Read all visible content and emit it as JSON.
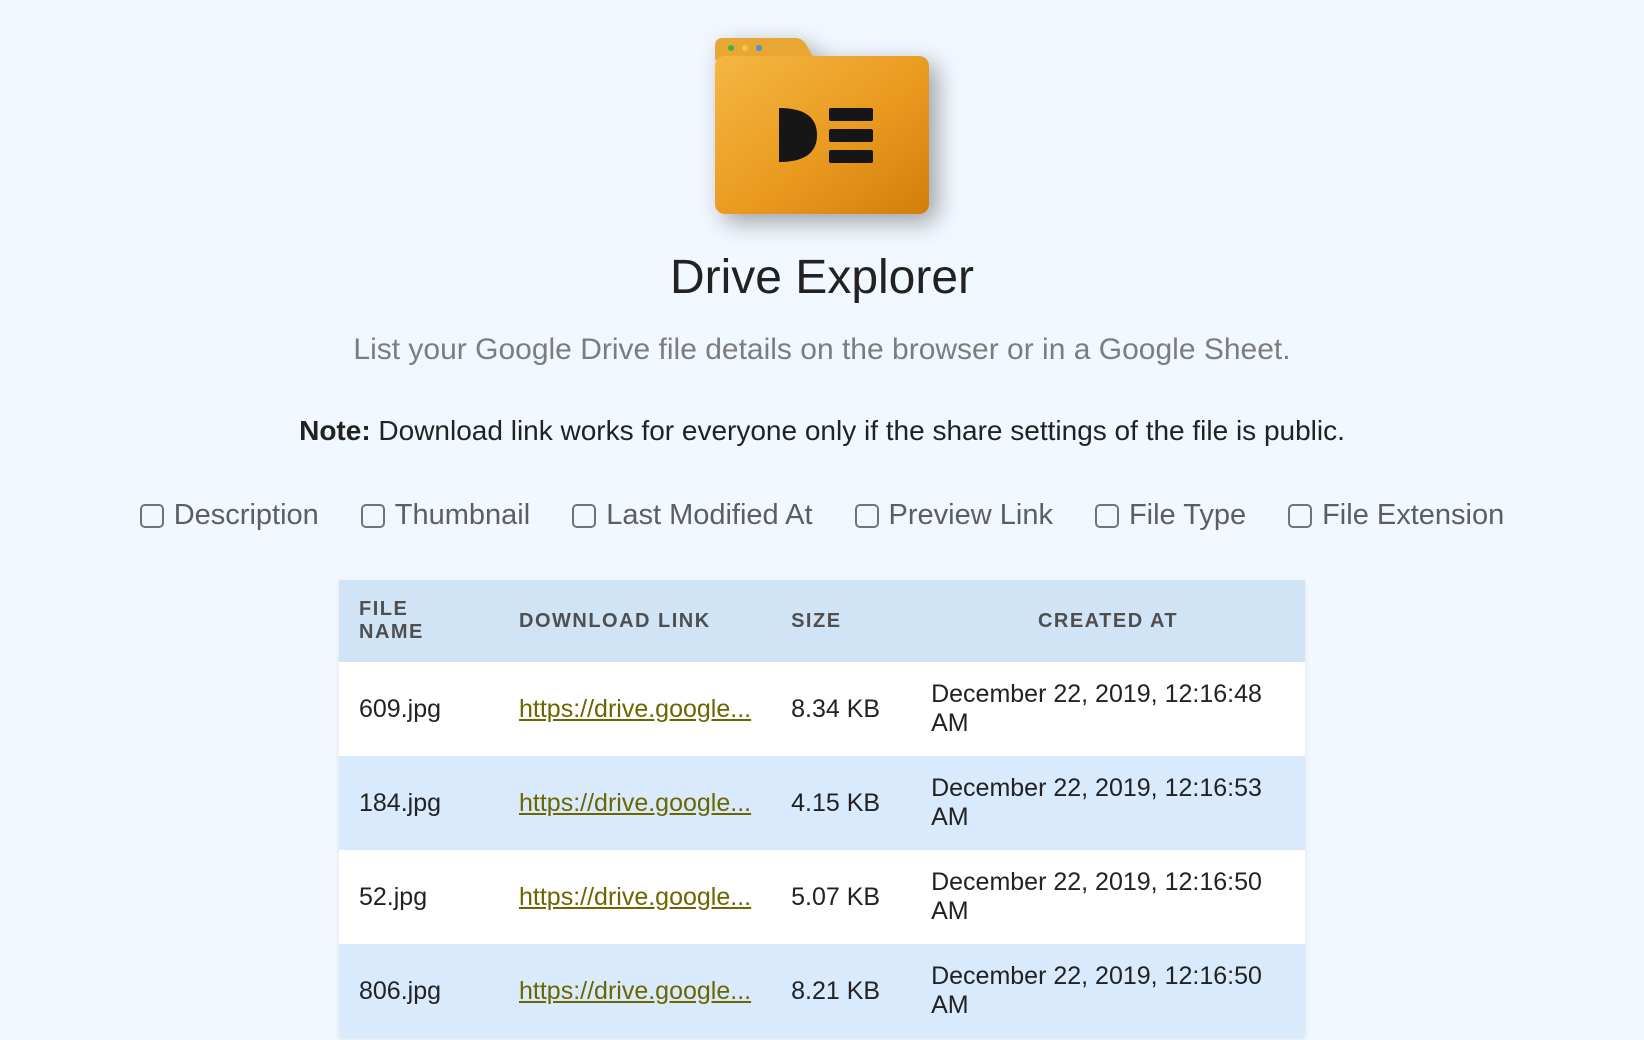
{
  "header": {
    "title": "Drive Explorer",
    "subtitle": "List your Google Drive file details on the browser or in a Google Sheet.",
    "note_label": "Note:",
    "note_text": "Download link works for everyone only if the share settings of the file is public."
  },
  "checkboxes": {
    "items": [
      {
        "label": "Description"
      },
      {
        "label": "Thumbnail"
      },
      {
        "label": "Last Modified At"
      },
      {
        "label": "Preview Link"
      },
      {
        "label": "File Type"
      },
      {
        "label": "File Extension"
      }
    ]
  },
  "table": {
    "headers": {
      "filename": "FILE NAME",
      "download": "DOWNLOAD LINK",
      "size": "SIZE",
      "created": "CREATED AT"
    },
    "rows": [
      {
        "filename": "609.jpg",
        "download": "https://drive.google...",
        "size": "8.34 KB",
        "created": "December 22, 2019, 12:16:48 AM"
      },
      {
        "filename": "184.jpg",
        "download": "https://drive.google...",
        "size": "4.15 KB",
        "created": "December 22, 2019, 12:16:53 AM"
      },
      {
        "filename": "52.jpg",
        "download": "https://drive.google...",
        "size": "5.07 KB",
        "created": "December 22, 2019, 12:16:50 AM"
      },
      {
        "filename": "806.jpg",
        "download": "https://drive.google...",
        "size": "8.21 KB",
        "created": "December 22, 2019, 12:16:50 AM"
      }
    ]
  }
}
